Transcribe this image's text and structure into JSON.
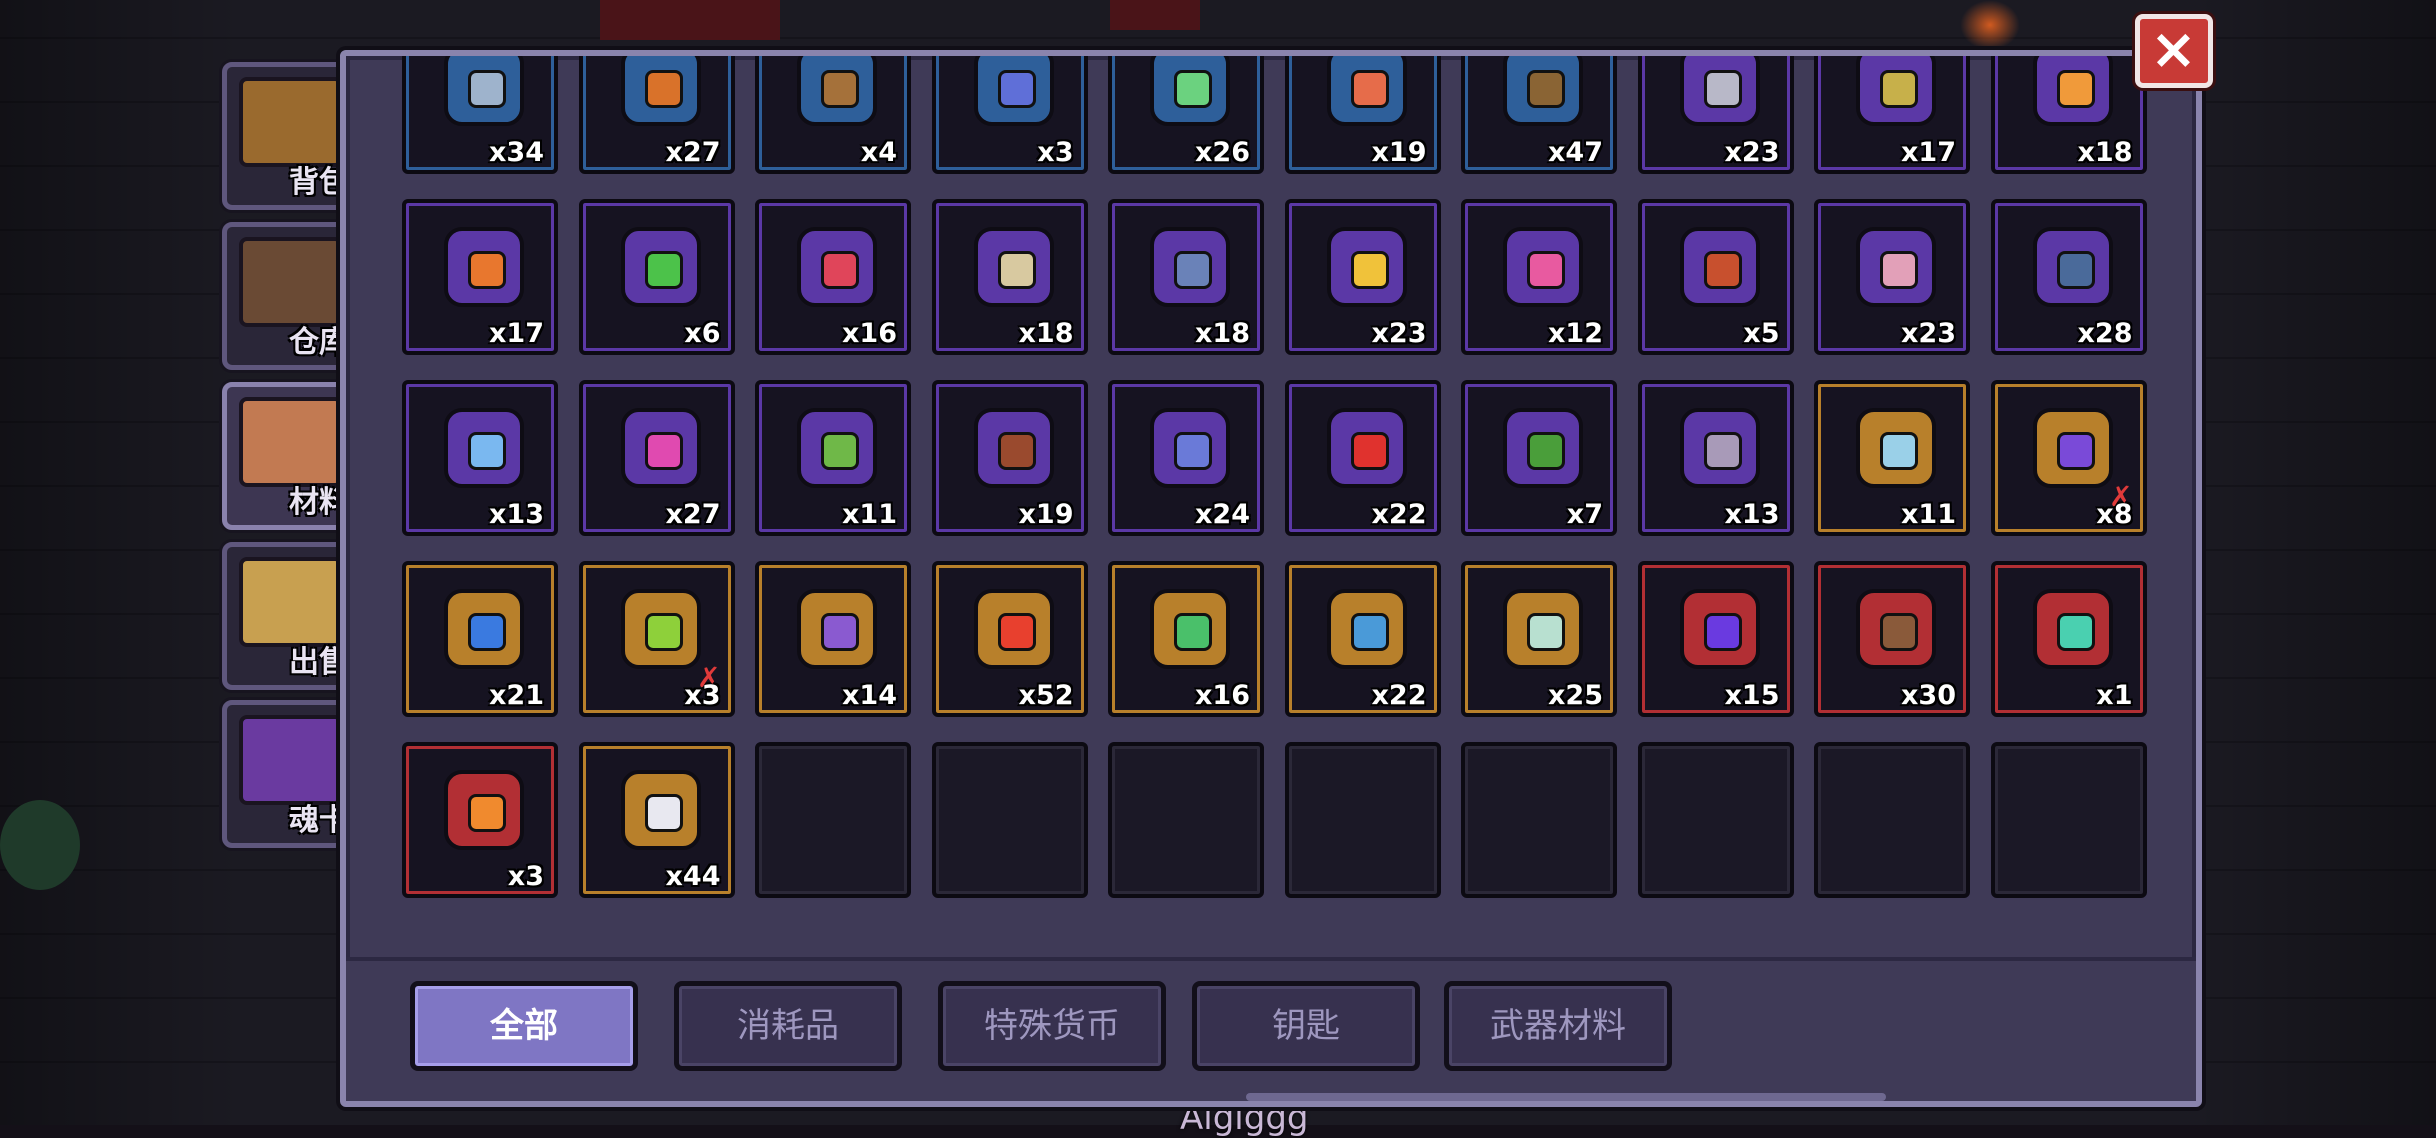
{
  "side_tabs": [
    {
      "label": "背包",
      "icon": "chest-icon",
      "active": false
    },
    {
      "label": "仓库",
      "icon": "storage-chest-icon",
      "active": false
    },
    {
      "label": "材料",
      "icon": "materials-book-icon",
      "active": true
    },
    {
      "label": "出售",
      "icon": "sell-bag-icon",
      "active": false
    },
    {
      "label": "魂卡",
      "icon": "soul-card-icon",
      "active": false
    }
  ],
  "close": {
    "label": "×",
    "icon": "close-icon"
  },
  "rarity_colors": {
    "blue": "#2e5f9a",
    "purple": "#5b38a6",
    "gold": "#b8802b",
    "red": "#b22f34"
  },
  "items": [
    {
      "icon": "slime-icon",
      "count": "x34",
      "rarity": "blue",
      "color": "#9eb3cc"
    },
    {
      "icon": "lantern-icon",
      "count": "x27",
      "rarity": "blue",
      "color": "#d9722a"
    },
    {
      "icon": "tablet-icon",
      "count": "x4",
      "rarity": "blue",
      "color": "#a5713a"
    },
    {
      "icon": "gun-icon",
      "count": "x3",
      "rarity": "blue",
      "color": "#5f6fd8"
    },
    {
      "icon": "crystal-shard-icon",
      "count": "x26",
      "rarity": "blue",
      "color": "#6bd27f"
    },
    {
      "icon": "horn-icon",
      "count": "x19",
      "rarity": "blue",
      "color": "#e66c4a"
    },
    {
      "icon": "stick-icon",
      "count": "x47",
      "rarity": "blue",
      "color": "#8a6434"
    },
    {
      "icon": "coin-icon",
      "count": "x23",
      "rarity": "purple",
      "color": "#b8b8c8"
    },
    {
      "icon": "bell-icon",
      "count": "x17",
      "rarity": "purple",
      "color": "#c7b04a"
    },
    {
      "icon": "heart-amulet-icon",
      "count": "x18",
      "rarity": "purple",
      "color": "#f09a3a"
    },
    {
      "icon": "ring-icon",
      "count": "x17",
      "rarity": "purple",
      "color": "#e8772e"
    },
    {
      "icon": "green-orb-icon",
      "count": "x6",
      "rarity": "purple",
      "color": "#4cc24a"
    },
    {
      "icon": "necklace-icon",
      "count": "x16",
      "rarity": "purple",
      "color": "#e0455a"
    },
    {
      "icon": "scroll-icon",
      "count": "x18",
      "rarity": "purple",
      "color": "#d8c9a0"
    },
    {
      "icon": "shield-icon",
      "count": "x18",
      "rarity": "purple",
      "color": "#6a82b8"
    },
    {
      "icon": "red-gem-pendant-icon",
      "count": "x23",
      "rarity": "purple",
      "color": "#f0c23a"
    },
    {
      "icon": "pink-crystal-icon",
      "count": "x12",
      "rarity": "purple",
      "color": "#e85aa0"
    },
    {
      "icon": "red-pot-icon",
      "count": "x5",
      "rarity": "purple",
      "color": "#c8502e"
    },
    {
      "icon": "brush-icon",
      "count": "x23",
      "rarity": "purple",
      "color": "#e2a0b8"
    },
    {
      "icon": "armor-icon",
      "count": "x28",
      "rarity": "purple",
      "color": "#4a6a9a"
    },
    {
      "icon": "blue-dagger-icon",
      "count": "x13",
      "rarity": "purple",
      "color": "#7ab8f0"
    },
    {
      "icon": "pink-frog-icon",
      "count": "x27",
      "rarity": "purple",
      "color": "#e04ab0"
    },
    {
      "icon": "green-rifle-icon",
      "count": "x11",
      "rarity": "purple",
      "color": "#6fb848"
    },
    {
      "icon": "brown-crossbow-icon",
      "count": "x19",
      "rarity": "purple",
      "color": "#9a4a2e"
    },
    {
      "icon": "blue-sword-icon",
      "count": "x24",
      "rarity": "purple",
      "color": "#6a7ad8"
    },
    {
      "icon": "red-potion-icon",
      "count": "x22",
      "rarity": "purple",
      "color": "#e0322e"
    },
    {
      "icon": "cactus-icon",
      "count": "x7",
      "rarity": "purple",
      "color": "#4a9e3a"
    },
    {
      "icon": "mask-icon",
      "count": "x13",
      "rarity": "purple",
      "color": "#a89ab8"
    },
    {
      "icon": "ice-sword-icon",
      "count": "x11",
      "rarity": "gold",
      "color": "#9ad0e8"
    },
    {
      "icon": "purple-staff-icon",
      "count": "x8",
      "rarity": "gold",
      "color": "#7a4ad8",
      "mark": "✗"
    },
    {
      "icon": "blue-flask-icon",
      "count": "x21",
      "rarity": "gold",
      "color": "#3a7ae0"
    },
    {
      "icon": "green-frog-icon",
      "count": "x3",
      "rarity": "gold",
      "color": "#8ed03a",
      "mark": "✗"
    },
    {
      "icon": "pickaxe-icon",
      "count": "x14",
      "rarity": "gold",
      "color": "#8a5ad0"
    },
    {
      "icon": "red-flower-icon",
      "count": "x52",
      "rarity": "gold",
      "color": "#e8402e"
    },
    {
      "icon": "green-boot-icon",
      "count": "x16",
      "rarity": "gold",
      "color": "#4ac06a"
    },
    {
      "icon": "blue-cat-icon",
      "count": "x22",
      "rarity": "gold",
      "color": "#4a9ad8"
    },
    {
      "icon": "ghost-fish-icon",
      "count": "x25",
      "rarity": "gold",
      "color": "#b8e0d0"
    },
    {
      "icon": "purple-blade-icon",
      "count": "x15",
      "rarity": "red",
      "color": "#6a3ae0"
    },
    {
      "icon": "drill-icon",
      "count": "x30",
      "rarity": "red",
      "color": "#8a5a3a"
    },
    {
      "icon": "jade-sword-icon",
      "count": "x1",
      "rarity": "red",
      "color": "#4ad0b0"
    },
    {
      "icon": "sun-gem-icon",
      "count": "x3",
      "rarity": "red",
      "color": "#f08a2e"
    },
    {
      "icon": "white-pearl-icon",
      "count": "x44",
      "rarity": "gold",
      "color": "#e8e8f0"
    }
  ],
  "filters": [
    {
      "label": "全部",
      "active": true
    },
    {
      "label": "消耗品",
      "active": false
    },
    {
      "label": "特殊货币",
      "active": false
    },
    {
      "label": "钥匙",
      "active": false
    },
    {
      "label": "武器材料",
      "active": false
    }
  ],
  "player_name": "Aigiggg"
}
